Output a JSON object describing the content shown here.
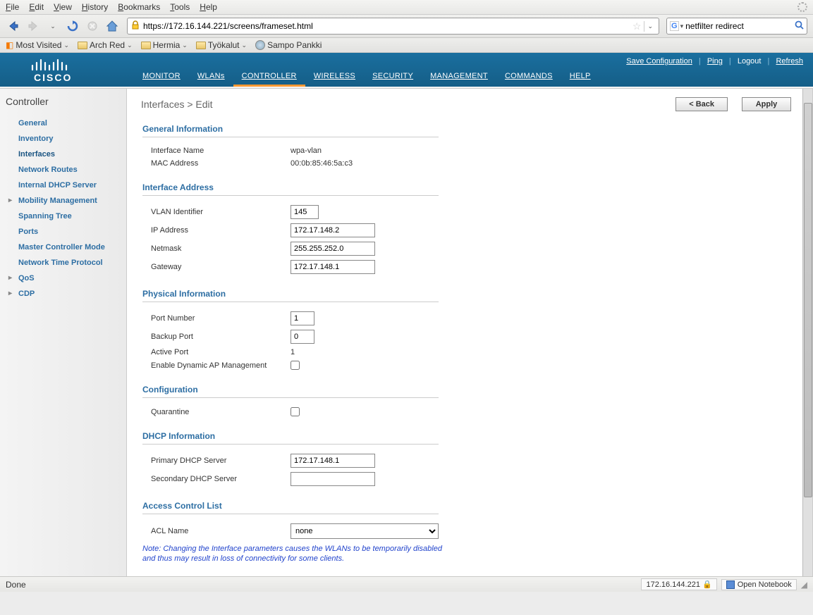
{
  "browser": {
    "menus": [
      "File",
      "Edit",
      "View",
      "History",
      "Bookmarks",
      "Tools",
      "Help"
    ],
    "url": "https://172.16.144.221/screens/frameset.html",
    "search_value": "netfilter redirect",
    "bookmarks": [
      {
        "label": "Most Visited",
        "icon": "mv"
      },
      {
        "label": "Arch Red",
        "icon": "folder"
      },
      {
        "label": "Hermia",
        "icon": "folder"
      },
      {
        "label": "Työkalut",
        "icon": "folder"
      },
      {
        "label": "Sampo Pankki",
        "icon": "globe"
      }
    ]
  },
  "cisco": {
    "toplinks": {
      "save": "Save Configuration",
      "ping": "Ping",
      "logout": "Logout",
      "refresh": "Refresh"
    },
    "nav": [
      "MONITOR",
      "WLANs",
      "CONTROLLER",
      "WIRELESS",
      "SECURITY",
      "MANAGEMENT",
      "COMMANDS",
      "HELP"
    ],
    "nav_active_index": 2
  },
  "sidebar": {
    "title": "Controller",
    "items": [
      {
        "label": "General"
      },
      {
        "label": "Inventory"
      },
      {
        "label": "Interfaces",
        "active": true
      },
      {
        "label": "Network Routes"
      },
      {
        "label": "Internal DHCP Server"
      },
      {
        "label": "Mobility Management",
        "exp": true
      },
      {
        "label": "Spanning Tree"
      },
      {
        "label": "Ports"
      },
      {
        "label": "Master Controller Mode"
      },
      {
        "label": "Network Time Protocol"
      },
      {
        "label": "QoS",
        "exp": true
      },
      {
        "label": "CDP",
        "exp": true
      }
    ]
  },
  "content": {
    "title": "Interfaces > Edit",
    "buttons": {
      "back": "< Back",
      "apply": "Apply"
    },
    "sections": {
      "general": {
        "head": "General Information",
        "interface_name_lbl": "Interface Name",
        "interface_name_val": "wpa-vlan",
        "mac_lbl": "MAC Address",
        "mac_val": "00:0b:85:46:5a:c3"
      },
      "addr": {
        "head": "Interface Address",
        "vlan_lbl": "VLAN Identifier",
        "vlan_val": "145",
        "ip_lbl": "IP Address",
        "ip_val": "172.17.148.2",
        "netmask_lbl": "Netmask",
        "netmask_val": "255.255.252.0",
        "gateway_lbl": "Gateway",
        "gateway_val": "172.17.148.1"
      },
      "phys": {
        "head": "Physical Information",
        "port_lbl": "Port Number",
        "port_val": "1",
        "backup_lbl": "Backup Port",
        "backup_val": "0",
        "active_lbl": "Active Port",
        "active_val": "1",
        "dynap_lbl": "Enable Dynamic AP Management"
      },
      "config": {
        "head": "Configuration",
        "quarantine_lbl": "Quarantine"
      },
      "dhcp": {
        "head": "DHCP Information",
        "primary_lbl": "Primary DHCP Server",
        "primary_val": "172.17.148.1",
        "secondary_lbl": "Secondary DHCP Server",
        "secondary_val": ""
      },
      "acl": {
        "head": "Access Control List",
        "name_lbl": "ACL Name",
        "name_val": "none"
      }
    },
    "note": "Note: Changing the Interface parameters causes the WLANs to be temporarily disabled and thus may result in loss of connectivity for some clients."
  },
  "statusbar": {
    "left": "Done",
    "host": "172.16.144.221",
    "notebook": "Open Notebook"
  }
}
